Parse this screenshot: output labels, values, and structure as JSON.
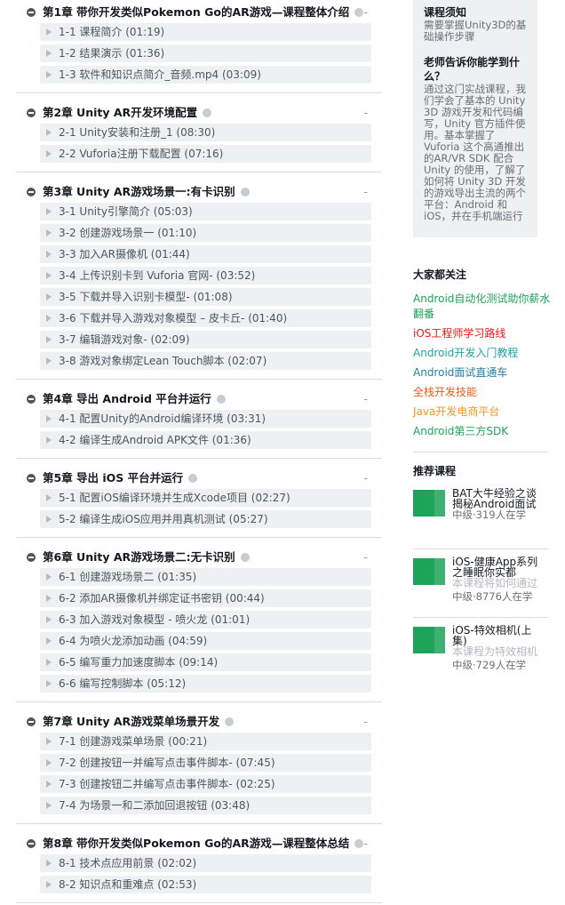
{
  "chapters": [
    {
      "title": "第1章 带你开发类似Pokemon Go的AR游戏—课程整体介绍",
      "lessons": [
        "1-1 课程简介 (01:19)",
        "1-2 结果演示 (01:36)",
        "1-3 软件和知识点简介_音频.mp4 (03:09)"
      ]
    },
    {
      "title": "第2章 Unity AR开发环境配置",
      "lessons": [
        "2-1 Unity安装和注册_1 (08:30)",
        "2-2 Vuforia注册下载配置 (07:16)"
      ]
    },
    {
      "title": "第3章 Unity AR游戏场景一:有卡识别",
      "lessons": [
        "3-1 Unity引擎简介 (05:03)",
        "3-2 创建游戏场景一 (01:10)",
        "3-3 加入AR摄像机 (01:44)",
        "3-4 上传识别卡到 Vuforia 官网- (03:52)",
        "3-5 下载并导入识别卡模型- (01:08)",
        "3-6 下载并导入游戏对象模型 – 皮卡丘- (01:40)",
        "3-7 编辑游戏对象- (02:09)",
        "3-8 游戏对象绑定Lean Touch脚本 (02:07)"
      ]
    },
    {
      "title": "第4章 导出 Android 平台并运行",
      "lessons": [
        "4-1 配置Unity的Android编译环境 (03:31)",
        "4-2 编译生成Android APK文件 (01:36)"
      ]
    },
    {
      "title": "第5章 导出 iOS 平台并运行",
      "lessons": [
        "5-1 配置iOS编译环境并生成Xcode项目 (02:27)",
        "5-2 编译生成iOS应用并用真机测试 (05:27)"
      ]
    },
    {
      "title": "第6章 Unity AR游戏场景二:无卡识别",
      "lessons": [
        "6-1 创建游戏场景二 (01:35)",
        "6-2 添加AR摄像机并绑定证书密钥 (00:44)",
        "6-3 加入游戏对象模型 - 喷火龙 (01:01)",
        "6-4 为喷火龙添加动画 (04:59)",
        "6-5 编写重力加速度脚本 (09:14)",
        "6-6 编写控制脚本 (05:12)"
      ]
    },
    {
      "title": "第7章 Unity AR游戏菜单场景开发",
      "lessons": [
        "7-1 创建游戏菜单场景 (00:21)",
        "7-2 创建按钮一并编写点击事件脚本- (07:45)",
        "7-3 创建按钮二并编写点击事件脚本- (02:25)",
        "7-4 为场景一和二添加回退按钮 (03:48)"
      ]
    },
    {
      "title": "第8章 带你开发类似Pokemon Go的AR游戏—课程整体总结",
      "lessons": [
        "8-1 技术点应用前景 (02:02)",
        "8-2 知识点和重难点 (02:53)"
      ]
    }
  ],
  "sidebar": {
    "prereq_title": "课程须知",
    "prereq_text": "需要掌握Unity3D的基础操作步骤",
    "learn_title": "老师告诉你能学到什么？",
    "learn_text": "通过这门实战课程，我们学会了基本的 Unity 3D 游戏开发和代码编写，Unity 官方插件使用。基本掌握了Vuforia 这个高通推出的AR/VR SDK 配合Unity 的使用，了解了如何将 Unity 3D 开发的游戏导出主流的两个平台：Android 和 iOS，并在手机端运行",
    "follow_title": "大家都关注",
    "tags": [
      {
        "label": "Android自动化测试助你薪水翻番",
        "color": "#1ea35a"
      },
      {
        "label": "iOS工程师学习路线",
        "color": "#f01414"
      },
      {
        "label": "Android开发入门教程",
        "color": "#1ea3a3"
      },
      {
        "label": "Android面试直通车",
        "color": "#1e7fa3"
      },
      {
        "label": "全栈开发技能",
        "color": "#f05a14"
      },
      {
        "label": "Java开发电商平台",
        "color": "#f0961e"
      },
      {
        "label": "Android第三方SDK",
        "color": "#1ea35a"
      }
    ],
    "recommend_title": "推荐课程",
    "courses": [
      {
        "name": "BAT大牛经验之谈揭秘Android面试",
        "desc": "",
        "meta": "中级·319人在学"
      },
      {
        "name": "iOS-健康App系列之睡眠你实都",
        "desc": "本课程将如何通过苹果Health",
        "meta": "中级·8776人在学"
      },
      {
        "name": "iOS-特效相机(上集)",
        "desc": "本课程为特效相机课程第一部",
        "meta": "中级·729人在学"
      }
    ]
  }
}
